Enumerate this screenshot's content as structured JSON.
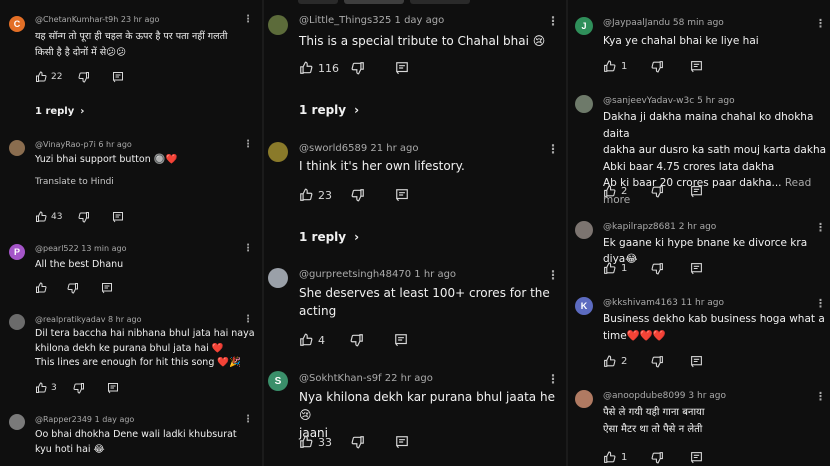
{
  "colors": {
    "background": "#0f0f0f",
    "text": "#f1f1f1",
    "meta": "#aaaaaa"
  },
  "column1": [
    {
      "avatar_letter": "C",
      "avatar_color": "#e36f26",
      "handle": "@ChetanKumhar-t9h",
      "time": "23 hr ago",
      "text_lines": [
        "यह सॉन्ग तो पूरा ही चहल के ऊपर है पर पता नहीं गलती",
        "किसी है है दोनों में से😕😕"
      ],
      "likes": "22",
      "reply_label": "1 reply"
    },
    {
      "avatar_letter": "",
      "avatar_color": "#8a6d4f",
      "handle": "@VinayRao-p7i",
      "time": "6 hr ago",
      "text_lines": [
        "Yuzi bhai support button 🔘❤️"
      ],
      "translate_label": "Translate to Hindi",
      "likes": "43"
    },
    {
      "avatar_letter": "P",
      "avatar_color": "#a455c8",
      "handle": "@pearl522",
      "time": "13 min ago",
      "text_lines": [
        "All the best Dhanu"
      ],
      "likes": ""
    },
    {
      "avatar_letter": "",
      "avatar_color": "#6b6b6b",
      "handle": "@realpratikyadav",
      "time": "8 hr ago",
      "text_lines": [
        "Dil tera baccha hai nibhana bhul jata hai naya",
        "khilona dekh ke purana bhul jata hai ❤️",
        "This lines are enough for hit this song ❤️🎉"
      ],
      "likes": "3"
    },
    {
      "avatar_letter": "",
      "avatar_color": "#7a7a7a",
      "handle": "@Rapper2349",
      "time": "1 day ago",
      "text_lines": [
        "Oo bhai  dhokha Dene wali ladki khubsurat",
        "kyu hoti hai 😂"
      ]
    }
  ],
  "column2": [
    {
      "avatar_color": "#5c6b3a",
      "handle": "@Little_Things325",
      "time": "1 day ago",
      "text_lines": [
        "This is a special tribute to Chahal bhai 😢"
      ],
      "likes": "116",
      "reply_label": "1 reply"
    },
    {
      "avatar_color": "#8a7a2a",
      "handle": "@sworld6589",
      "time": "21 hr ago",
      "text_lines": [
        "I think it's her own lifestory."
      ],
      "likes": "23",
      "reply_label": "1 reply"
    },
    {
      "avatar_color": "#9aa0a8",
      "handle": "@gurpreetsingh48470",
      "time": "1 hr ago",
      "text_lines": [
        "She deserves at least 100+ crores for the",
        "acting"
      ],
      "likes": "4"
    },
    {
      "avatar_letter": "S",
      "avatar_color": "#3a8f6a",
      "handle": "@SokhtKhan-s9f",
      "time": "22 hr ago",
      "text_lines": [
        "Nya khilona dekh kar purana bhul jaata he 😢",
        "jaani"
      ],
      "likes": "33"
    }
  ],
  "column3": [
    {
      "avatar_letter": "J",
      "avatar_color": "#2f8f5a",
      "handle": "@JaypaalJandu",
      "time": "58 min ago",
      "text_lines": [
        "Kya ye chahal bhai ke liye hai"
      ],
      "likes": "1"
    },
    {
      "avatar_color": "#6e7a6a",
      "handle": "@sanjeevYadav-w3c",
      "time": "5 hr ago",
      "text_lines": [
        "Dakha ji dakha maina chahal ko dhokha daita",
        "dakha aur dusro ka sath mouj karta dakha",
        "Abki baar 4.75 crores lata dakha",
        "Ab ki baar 20 crores paar dakha..."
      ],
      "read_more": "Read more",
      "likes": "2"
    },
    {
      "avatar_color": "#7c7470",
      "handle": "@kapilrapz8681",
      "time": "2 hr ago",
      "text_lines": [
        "Ek gaane ki hype bnane ke divorce kra diya😂"
      ],
      "likes": "1"
    },
    {
      "avatar_letter": "K",
      "avatar_color": "#5c6bc0",
      "handle": "@kkshivam4163",
      "time": "11 hr ago",
      "text_lines": [
        "Business dekho kab business hoga what a",
        "time❤️❤️❤️"
      ],
      "likes": "2"
    },
    {
      "avatar_color": "#b07a62",
      "handle": "@anoopdube8099",
      "time": "3 hr ago",
      "text_lines": [
        "पैसे ले गयी यही गाना बनाया",
        "ऐसा मैटर था तो पैसे न लेती"
      ],
      "likes": "1"
    }
  ]
}
